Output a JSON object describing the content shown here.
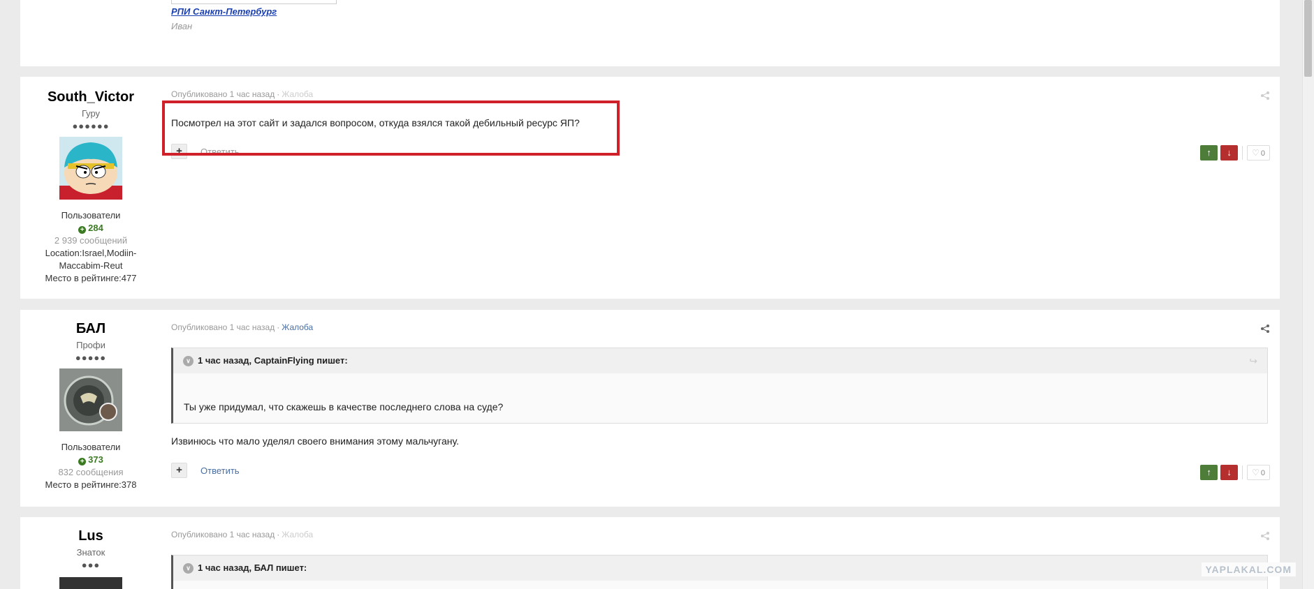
{
  "top_post": {
    "link": "РПИ Санкт-Петербург",
    "sub": "Иван"
  },
  "posts": [
    {
      "username": "South_Victor",
      "rank": "Гуру",
      "pips": "●●●●●●",
      "group": "Пользователи",
      "reputation": "284",
      "posts_count": "2 939 сообщений",
      "info": "Location:Israel,Modiin-Maccabim-Reut",
      "rating": "Место в рейтинге:477",
      "published": "Опубликовано 1 час назад",
      "report": "Жалоба",
      "text": "Посмотрел на этот сайт и задался вопросом, откуда взялся такой дебильный ресурс ЯП?",
      "reply": "Ответить",
      "likes": "0"
    },
    {
      "username": "БАЛ",
      "rank": "Профи",
      "pips": "●●●●●",
      "group": "Пользователи",
      "reputation": "373",
      "posts_count": "832 сообщения",
      "rating": "Место в рейтинге:378",
      "published": "Опубликовано 1 час назад",
      "report": "Жалоба",
      "quote_head": "1 час назад, CaptainFlying пишет:",
      "quote_text": "Ты уже придумал, что скажешь в качестве последнего слова на суде?",
      "text": "Извинюсь что мало уделял своего внимания этому мальчугану.",
      "reply": "Ответить",
      "likes": "0"
    },
    {
      "username": "Lus",
      "rank": "Знаток",
      "pips": "●●●",
      "published": "Опубликовано 1 час назад",
      "report": "Жалоба",
      "quote_head": "1 час назад, БАЛ пишет:"
    }
  ],
  "icons": {
    "share": "share-icon",
    "upvote": "arrow-up-icon",
    "downvote": "arrow-down-icon",
    "like": "heart-icon",
    "quote_toggle": "chevron-down-icon",
    "quote_link": "reply-arrow-icon",
    "reputation": "plus-circle-icon"
  },
  "watermark": "YAPLAKAL.COM",
  "colors": {
    "upvote": "#4e7d3a",
    "downvote": "#b52f2f",
    "highlight": "#d0202a",
    "link": "#4a6fa0"
  }
}
